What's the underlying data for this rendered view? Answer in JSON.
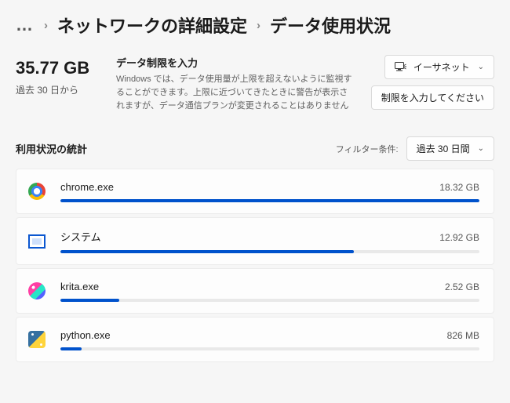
{
  "breadcrumb": {
    "ellipsis": "…",
    "parent": "ネットワークの詳細設定",
    "current": "データ使用状況"
  },
  "total": {
    "value": "35.77 GB",
    "sub": "過去 30 日から"
  },
  "limit": {
    "title": "データ制限を入力",
    "desc": "Windows では、データ使用量が上限を超えないように監視することができます。上限に近づいてきたときに警告が表示されますが、データ通信プランが変更されることはありません"
  },
  "buttons": {
    "adapter": "イーサネット",
    "enter_limit": "制限を入力してください"
  },
  "stats": {
    "heading": "利用状況の統計",
    "filter_label": "フィルター条件:",
    "filter_value": "過去 30 日間"
  },
  "apps": [
    {
      "name": "chrome.exe",
      "amount": "18.32 GB",
      "pct": 100,
      "icon": "chrome"
    },
    {
      "name": "システム",
      "amount": "12.92 GB",
      "pct": 70,
      "icon": "system"
    },
    {
      "name": "krita.exe",
      "amount": "2.52 GB",
      "pct": 14,
      "icon": "krita"
    },
    {
      "name": "python.exe",
      "amount": "826 MB",
      "pct": 5,
      "icon": "python"
    }
  ]
}
